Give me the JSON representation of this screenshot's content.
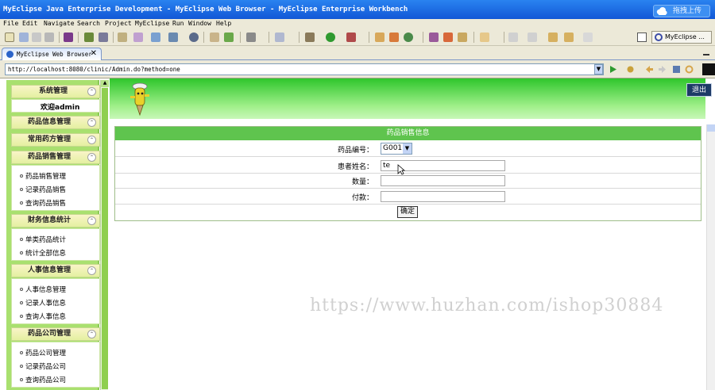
{
  "window": {
    "title": "MyEclipse Java Enterprise Development - MyEclipse Web Browser - MyEclipse Enterprise Workbench",
    "upload_label": "拖拽上传"
  },
  "menu": [
    "File",
    "Edit",
    "Navigate",
    "Search",
    "Project",
    "MyEclipse",
    "Run",
    "Window",
    "Help"
  ],
  "perspective": {
    "label": "MyEclipse ..."
  },
  "editor_tab": {
    "label": "MyEclipse Web Browser",
    "close": "✕"
  },
  "browser": {
    "url": "http://localhost:8080/clinic/Admin.do?method=one"
  },
  "sidebar": {
    "sections": [
      {
        "title": "系统管理",
        "welcome": "欢迎admin"
      },
      {
        "title": "药品信息管理"
      },
      {
        "title": "常用药方管理"
      },
      {
        "title": "药品销售管理",
        "items": [
          "药品销售管理",
          "记录药品销售",
          "查询药品销售"
        ]
      },
      {
        "title": "财务信息统计",
        "items": [
          "单类药品统计",
          "统计全部信息"
        ]
      },
      {
        "title": "人事信息管理",
        "items": [
          "人事信息管理",
          "记录人事信息",
          "查询人事信息"
        ]
      },
      {
        "title": "药品公司管理",
        "items": [
          "药品公司管理",
          "记录药品公司",
          "查询药品公司"
        ]
      }
    ]
  },
  "header": {
    "exit_label": "退出"
  },
  "form": {
    "title": "药品销售信息",
    "drug_code_label": "药品编号：",
    "drug_code_value": "G001",
    "patient_label": "患者姓名：",
    "patient_value": "te",
    "qty_label": "数量：",
    "qty_value": "",
    "pay_label": "付款：",
    "pay_value": "",
    "submit_label": "确定"
  },
  "watermark": "https://www.huzhan.com/ishop30884"
}
